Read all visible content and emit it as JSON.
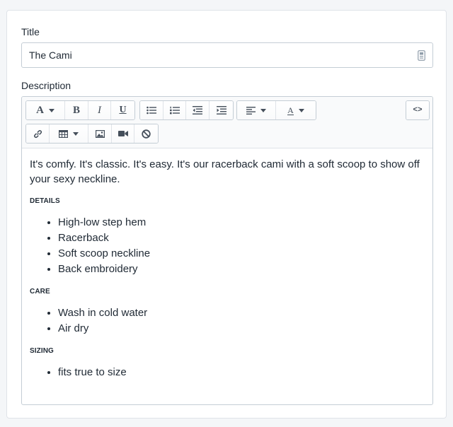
{
  "title_field": {
    "label": "Title",
    "value": "The Cami"
  },
  "description_field": {
    "label": "Description",
    "toolbar": {
      "row1": [
        "font-style-dropdown",
        "bold",
        "italic",
        "underline",
        "bulleted-list",
        "numbered-list",
        "outdent",
        "indent",
        "align-dropdown",
        "text-color-dropdown",
        "html-source"
      ],
      "row2": [
        "insert-link",
        "insert-table-dropdown",
        "insert-image",
        "insert-video",
        "clear-formatting"
      ],
      "font_glyph": "A",
      "bold_glyph": "B",
      "italic_glyph": "I",
      "underline_glyph": "U",
      "color_glyph": "A",
      "html_glyph": "<>"
    },
    "content": {
      "intro": "It's comfy. It's classic. It's easy. It's our racerback cami with a soft scoop to show off your sexy neckline.",
      "sections": [
        {
          "heading": "DETAILS",
          "items": [
            "High-low step hem",
            "Racerback",
            "Soft scoop neckline",
            "Back embroidery"
          ]
        },
        {
          "heading": "CARE",
          "items": [
            "Wash in cold water",
            "Air dry"
          ]
        },
        {
          "heading": "SIZING",
          "items": [
            "fits true to size"
          ]
        }
      ]
    }
  },
  "colors": {
    "background": "#f4f6f8",
    "card": "#ffffff",
    "border": "#c4cdd5",
    "text": "#212b36",
    "icon": "#454f5b"
  }
}
